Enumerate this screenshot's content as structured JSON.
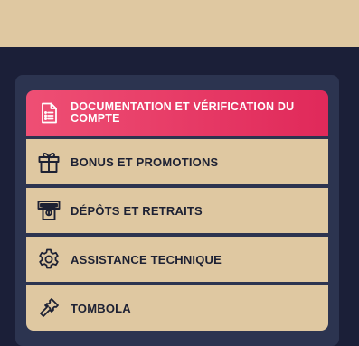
{
  "colors": {
    "header_band": "#dfc8a1",
    "background": "#1b1f38",
    "panel": "#2c3450",
    "item_bg": "#dfc8a1",
    "active_gradient_start": "#ee4f74",
    "active_gradient_end": "#e0295a",
    "label_dark": "#1d2133"
  },
  "menu": {
    "items": [
      {
        "label": "DOCUMENTATION ET VÉRIFICATION DU COMPTE",
        "icon": "document-icon",
        "active": true
      },
      {
        "label": "BONUS ET PROMOTIONS",
        "icon": "gift-icon",
        "active": false
      },
      {
        "label": "DÉPÔTS ET RETRAITS",
        "icon": "atm-cash-icon",
        "active": false
      },
      {
        "label": "ASSISTANCE TECHNIQUE",
        "icon": "gear-icon",
        "active": false
      },
      {
        "label": "TOMBOLA",
        "icon": "ticket-icon",
        "active": false
      }
    ]
  }
}
